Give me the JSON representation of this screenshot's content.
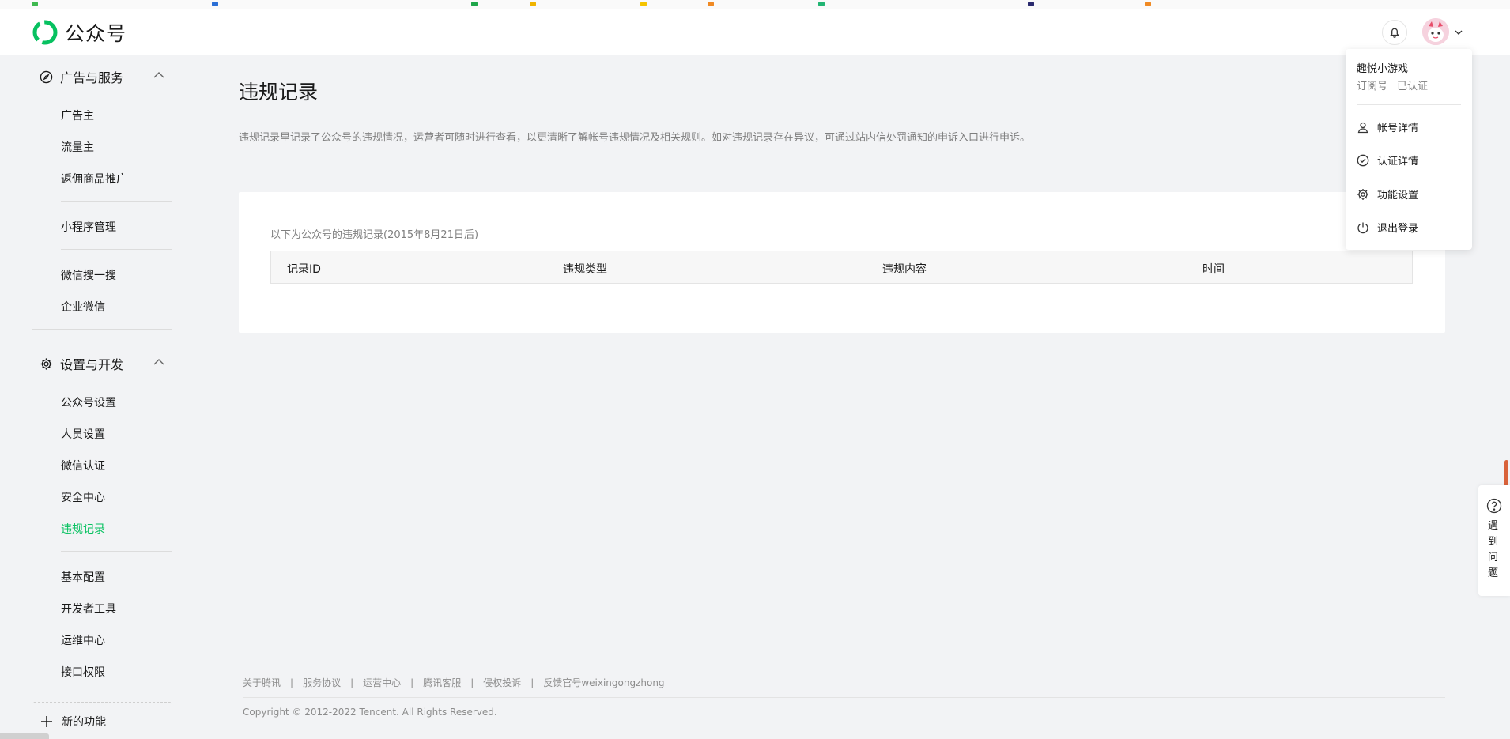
{
  "app": {
    "name": "公众号"
  },
  "sidebar": {
    "groups": [
      {
        "title": "广告与服务",
        "icon": "compass-icon",
        "items": [
          "广告主",
          "流量主",
          "返佣商品推广",
          "小程序管理",
          "微信搜一搜",
          "企业微信"
        ]
      },
      {
        "title": "设置与开发",
        "icon": "gear-icon",
        "items": [
          "公众号设置",
          "人员设置",
          "微信认证",
          "安全中心",
          "违规记录",
          "基本配置",
          "开发者工具",
          "运维中心",
          "接口权限"
        ]
      }
    ],
    "active_item": "违规记录",
    "new_feature_label": "新的功能"
  },
  "main": {
    "title": "违规记录",
    "description": "违规记录里记录了公众号的违规情况，运营者可随时进行查看，以更清晰了解帐号违规情况及相关规则。如对违规记录存在异议，可通过站内信处罚通知的申诉入口进行申诉。",
    "table_caption": "以下为公众号的违规记录(2015年8月21日后)",
    "columns": [
      "记录ID",
      "违规类型",
      "违规内容",
      "时间"
    ]
  },
  "footer": {
    "links": [
      "关于腾讯",
      "服务协议",
      "运营中心",
      "腾讯客服",
      "侵权投诉",
      "反馈官号weixingongzhong"
    ],
    "copyright": "Copyright © 2012-2022 Tencent. All Rights Reserved."
  },
  "account_menu": {
    "name": "趣悦小游戏",
    "type": "订阅号",
    "status": "已认证",
    "items": [
      {
        "label": "帐号详情",
        "icon": "user-icon"
      },
      {
        "label": "认证详情",
        "icon": "check-circle-icon"
      },
      {
        "label": "功能设置",
        "icon": "gear-icon"
      },
      {
        "label": "退出登录",
        "icon": "power-icon"
      }
    ]
  },
  "help": {
    "label": "遇到问题"
  },
  "colors": {
    "accent": "#07c160",
    "background": "#f2f3f5"
  }
}
